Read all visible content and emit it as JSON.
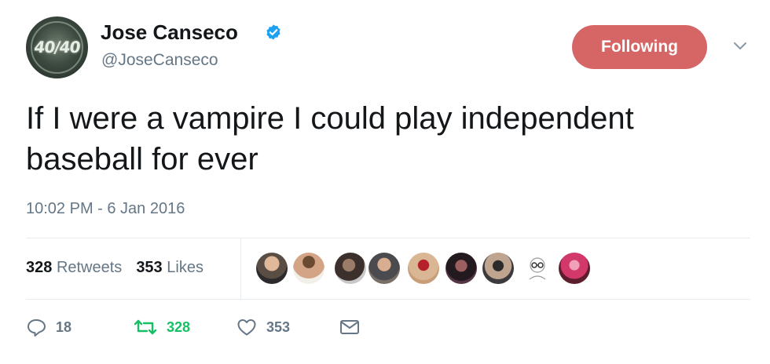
{
  "profile": {
    "name": "Jose Canseco",
    "handle": "@JoseCanseco",
    "avatar_text": "40/40",
    "verified_color": "#1da1f2"
  },
  "follow_button": {
    "label": "Following",
    "color": "#d66665"
  },
  "tweet": {
    "line1": "If I were a vampire I could play independent",
    "line2": "baseball for ever",
    "timestamp": "10:02 PM - 6 Jan 2016"
  },
  "stats": {
    "retweets_count": "328",
    "retweets_label": "Retweets",
    "likes_count": "353",
    "likes_label": "Likes"
  },
  "liker_avatars": [
    {
      "icon": "avatar-man-suit"
    },
    {
      "icon": "avatar-shirtless-man"
    },
    {
      "icon": "avatar-bearded-man"
    },
    {
      "icon": "avatar-man-smiling"
    },
    {
      "icon": "avatar-devil-mask"
    },
    {
      "icon": "avatar-woman-dark"
    },
    {
      "icon": "avatar-man-sunglasses"
    },
    {
      "icon": "avatar-sketch-glasses"
    },
    {
      "icon": "avatar-pink-hair"
    }
  ],
  "actions": {
    "reply_count": "18",
    "retweet_count": "328",
    "like_count": "353",
    "retweet_color": "#17bf63",
    "icon_color": "#657786"
  }
}
